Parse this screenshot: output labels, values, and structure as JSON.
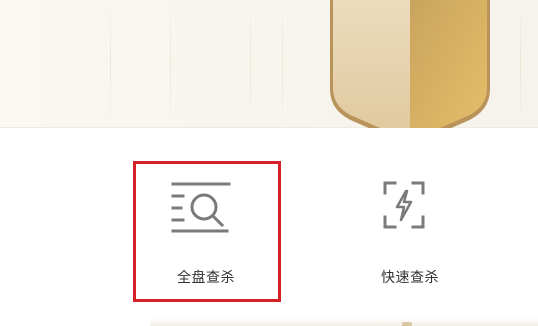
{
  "scan_actions": [
    {
      "label": "全盘查杀",
      "icon": "full-scan-icon"
    },
    {
      "label": "快速查杀",
      "icon": "quick-scan-icon"
    }
  ],
  "colors": {
    "selection_border": "#d32127",
    "icon_gray": "#7a7a7a",
    "shield_gold_light": "#e7cfa4",
    "shield_gold_dark": "#c9a35c",
    "hero_background": "#f8f5ee"
  }
}
